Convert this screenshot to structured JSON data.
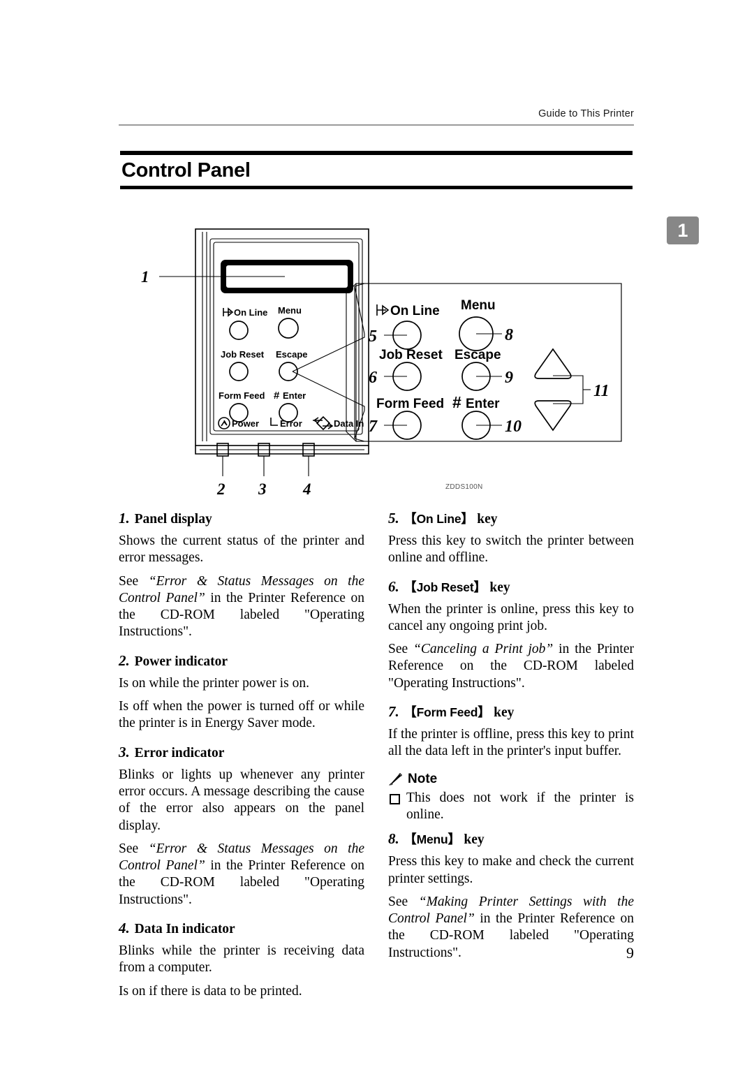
{
  "header": {
    "running_head": "Guide to This Printer",
    "chapter_tab": "1"
  },
  "title": "Control Panel",
  "figure": {
    "code": "ZDDS100N",
    "callout_numbers": [
      "1",
      "2",
      "3",
      "4",
      "5",
      "6",
      "7",
      "8",
      "9",
      "10",
      "11"
    ],
    "panel_keys": [
      {
        "label": "On Line",
        "icon": "online-arrow-icon"
      },
      {
        "label": "Menu",
        "icon": null
      },
      {
        "label": "Job Reset",
        "icon": null
      },
      {
        "label": "Escape",
        "icon": null
      },
      {
        "label": "Form Feed",
        "icon": null
      },
      {
        "label": "Enter",
        "icon": "hash-icon"
      }
    ],
    "indicators": [
      {
        "label": "Power",
        "icon": "power-bolt-icon"
      },
      {
        "label": "Error",
        "icon": "error-corner-icon"
      },
      {
        "label": "Data In",
        "icon": "data-in-diamond-icon"
      }
    ],
    "arrow_keys": [
      {
        "name": "up-arrow-key",
        "icon": "triangle-up-icon"
      },
      {
        "name": "down-arrow-key",
        "icon": "triangle-down-icon"
      }
    ]
  },
  "left_column": [
    {
      "num": "1.",
      "heading": "Panel display",
      "paragraphs": [
        {
          "runs": [
            {
              "t": "Shows the current status of the printer and error messages.",
              "i": false
            }
          ]
        },
        {
          "runs": [
            {
              "t": "See ",
              "i": false
            },
            {
              "t": "“Error & Status Messages on the Control Panel”",
              "i": true
            },
            {
              "t": " in the Printer Reference on the CD-ROM labeled \"Operating Instructions\".",
              "i": false
            }
          ]
        }
      ]
    },
    {
      "num": "2.",
      "heading": "Power indicator",
      "paragraphs": [
        {
          "runs": [
            {
              "t": "Is on while the printer power is on.",
              "i": false
            }
          ]
        },
        {
          "runs": [
            {
              "t": "Is off when the power is turned off or while the printer is in Energy Saver mode.",
              "i": false
            }
          ]
        }
      ]
    },
    {
      "num": "3.",
      "heading": "Error indicator",
      "paragraphs": [
        {
          "runs": [
            {
              "t": "Blinks or lights up whenever any printer error occurs. A message describing the cause of the error also appears on the panel display.",
              "i": false
            }
          ]
        },
        {
          "runs": [
            {
              "t": "See ",
              "i": false
            },
            {
              "t": "“Error & Status Messages on the Control Panel”",
              "i": true
            },
            {
              "t": " in the Printer Reference on the CD-ROM labeled \"Operating Instructions\".",
              "i": false
            }
          ]
        }
      ]
    },
    {
      "num": "4.",
      "heading": "Data In indicator",
      "paragraphs": [
        {
          "runs": [
            {
              "t": "Blinks while the printer is receiving data from a computer.",
              "i": false
            }
          ]
        },
        {
          "runs": [
            {
              "t": "Is on if there is data to be printed.",
              "i": false
            }
          ]
        }
      ]
    }
  ],
  "right_column": [
    {
      "num": "5.",
      "key": "On Line",
      "suffix": "key",
      "paragraphs": [
        {
          "runs": [
            {
              "t": "Press this key to switch the printer between online and offline.",
              "i": false
            }
          ]
        }
      ]
    },
    {
      "num": "6.",
      "key": "Job Reset",
      "suffix": "key",
      "paragraphs": [
        {
          "runs": [
            {
              "t": "When the printer is online, press this key to cancel any ongoing print job.",
              "i": false
            }
          ]
        },
        {
          "runs": [
            {
              "t": "See ",
              "i": false
            },
            {
              "t": "“Canceling a Print job”",
              "i": true
            },
            {
              "t": " in the Printer Reference on the CD-ROM labeled \"Operating Instructions\".",
              "i": false
            }
          ]
        }
      ]
    },
    {
      "num": "7.",
      "key": "Form Feed",
      "suffix": "key",
      "paragraphs": [
        {
          "runs": [
            {
              "t": "If the printer is offline, press this key to print all the data left in the printer's input buffer.",
              "i": false
            }
          ]
        }
      ],
      "note": {
        "title": "Note",
        "items": [
          "This does not work if the printer is online."
        ]
      }
    },
    {
      "num": "8.",
      "key": "Menu",
      "suffix": "key",
      "paragraphs": [
        {
          "runs": [
            {
              "t": "Press this key to make and check the current printer settings.",
              "i": false
            }
          ]
        },
        {
          "runs": [
            {
              "t": "See ",
              "i": false
            },
            {
              "t": "“Making Printer Settings with the Control Panel”",
              "i": true
            },
            {
              "t": " in the Printer Reference on the CD-ROM labeled \"Operating Instructions\".",
              "i": false
            }
          ]
        }
      ]
    }
  ],
  "page_number": "9",
  "colors": {
    "rule": "#000000",
    "header_rule": "#9a9a9a",
    "chapter_tab_bg": "#878787",
    "text": "#000000"
  }
}
